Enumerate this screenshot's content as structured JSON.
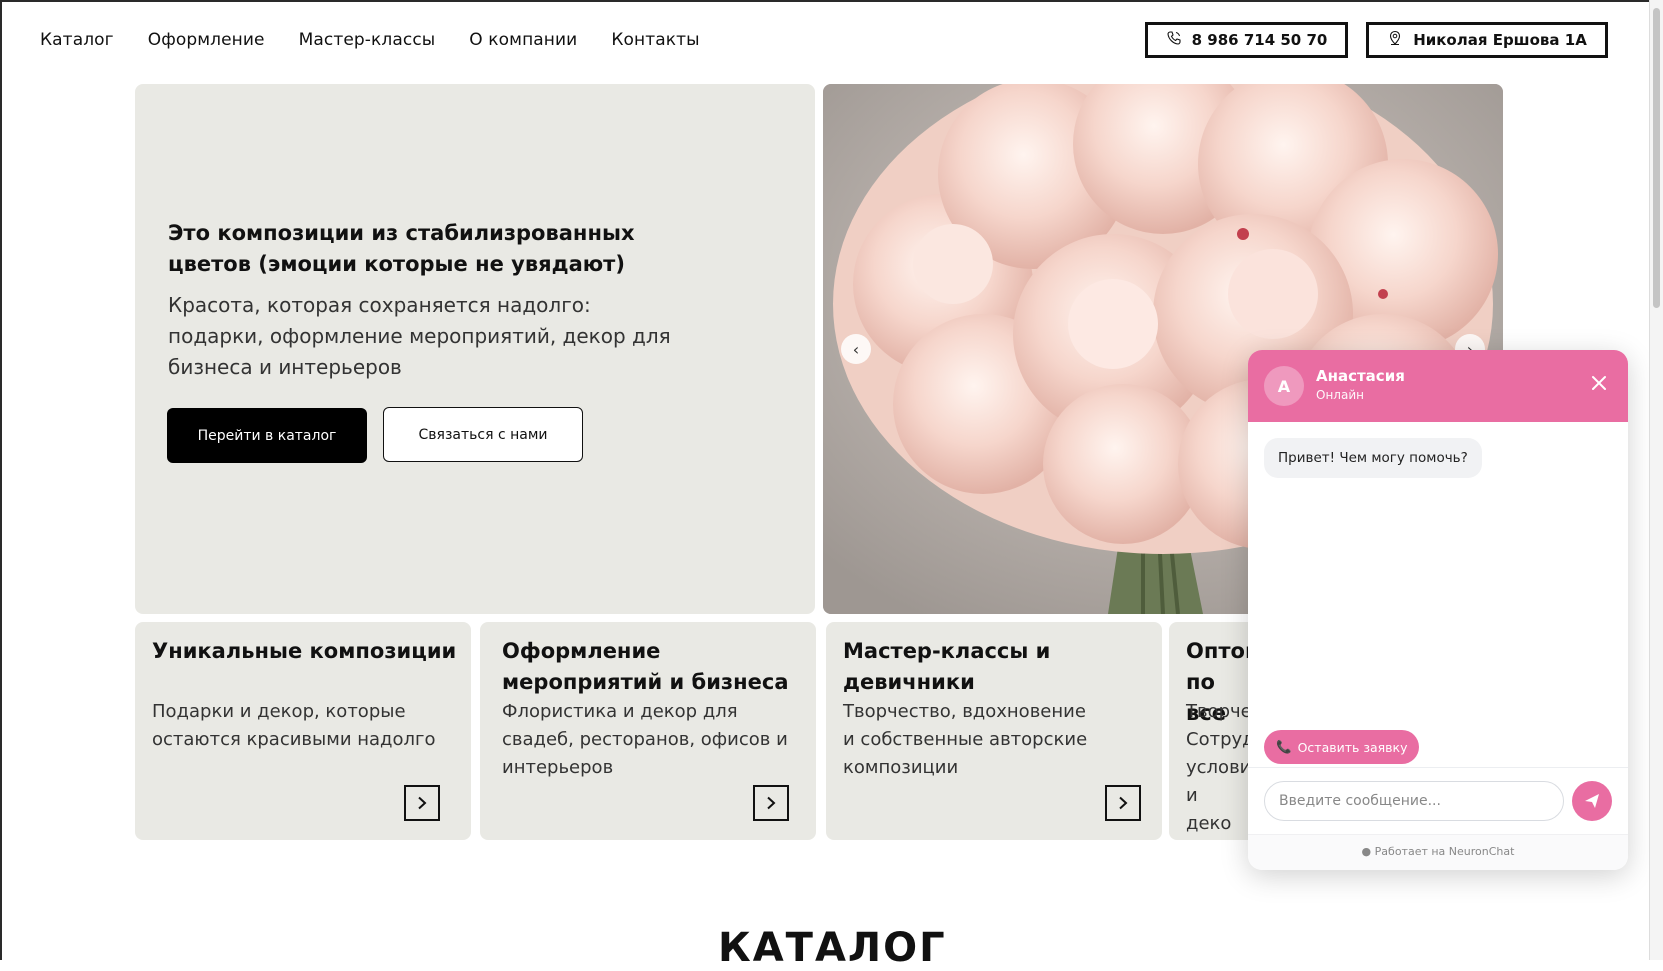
{
  "nav": {
    "items": [
      "Каталог",
      "Оформление",
      "Мастер-классы",
      "О компании",
      "Контакты"
    ]
  },
  "header": {
    "phone": "8 986 714 50 70",
    "address": "Николая Ершова 1А"
  },
  "hero": {
    "title": "Это композиции из стабилизрованных цветов (эмоции которые не увядают)",
    "subtitle": "Красота, которая сохраняется надолго: подарки, оформление мероприятий, декор для бизнеса и интерьеров",
    "primary_button": "Перейти в каталог",
    "secondary_button": "Связаться с нами"
  },
  "cards": [
    {
      "title": "Уникальные композиции",
      "text": "Подарки и декор, которые остаются красивыми надолго"
    },
    {
      "title": "Оформление мероприятий и бизнеса",
      "text": "Флористика и декор для свадеб, ресторанов, офисов и интерьеров"
    },
    {
      "title": "Мастер-классы и девичники",
      "text": "Творчество, вдохновение и собственные авторские композиции"
    },
    {
      "title": "Оптов по все",
      "text": "Творче Сотруд услови и деко"
    }
  ],
  "section": {
    "catalog_heading": "КАТАЛОГ"
  },
  "chat": {
    "avatar_letter": "А",
    "agent_name": "Анастасия",
    "status": "Онлайн",
    "greeting": "Привет! Чем могу помочь?",
    "cta": "Оставить заявку",
    "input_placeholder": "Введите сообщение...",
    "powered_by": "Работает на NeuronChat"
  },
  "colors": {
    "accent": "#e96da2",
    "card_bg": "#e9e9e4",
    "dark_button": "#000000"
  },
  "icons": [
    "phone-icon",
    "location-pin-icon",
    "chevron-left-icon",
    "chevron-right-icon",
    "close-icon",
    "send-icon",
    "chat-bubble-icon"
  ]
}
